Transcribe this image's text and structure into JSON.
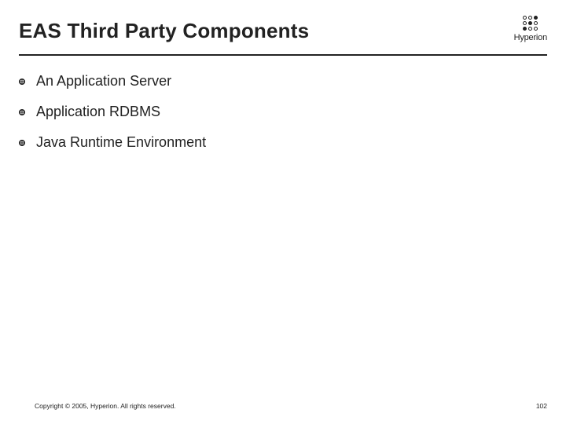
{
  "header": {
    "title": "EAS Third Party Components",
    "logo_text": "Hyperion"
  },
  "bullets": [
    {
      "text": "An Application Server"
    },
    {
      "text": "Application RDBMS"
    },
    {
      "text": "Java Runtime Environment"
    }
  ],
  "footer": {
    "copyright": "Copyright © 2005, Hyperion. All rights reserved.",
    "page_number": "102"
  }
}
